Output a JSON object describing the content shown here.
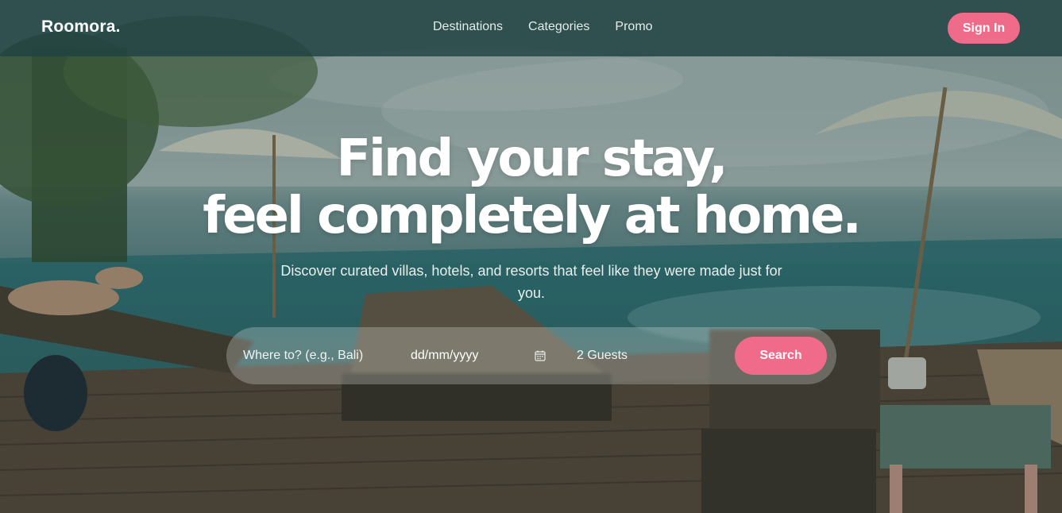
{
  "brand": {
    "logo": "Roomora."
  },
  "nav": {
    "links": [
      "Destinations",
      "Categories",
      "Promo"
    ],
    "signin_label": "Sign In"
  },
  "hero": {
    "headline_line1": "Find your stay,",
    "headline_line2": "feel completely at home.",
    "subtitle": "Discover curated villas, hotels, and resorts that feel like they were made just for you."
  },
  "search": {
    "where_placeholder": "Where to? (e.g., Bali)",
    "date_placeholder": "dd/mm/yyyy",
    "guests_value": "2 Guests",
    "button_label": "Search"
  },
  "colors": {
    "accent": "#f06a8a",
    "navbar_bg": "#204242",
    "text_light": "#ffffff"
  },
  "icons": {
    "date_field": "calendar-icon"
  }
}
